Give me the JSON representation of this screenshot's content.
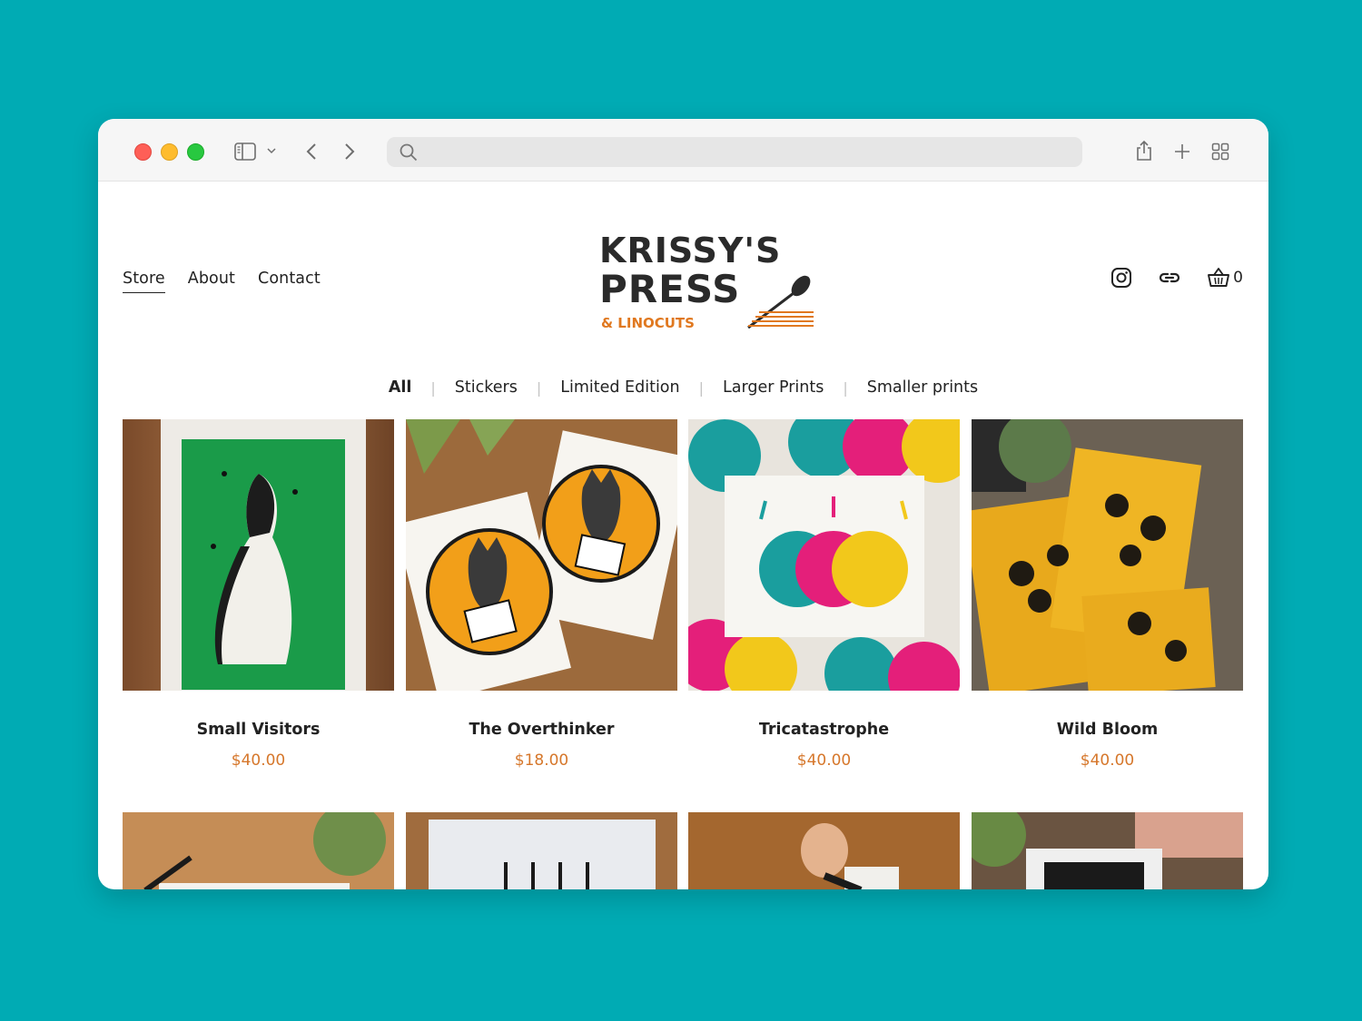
{
  "browser": {
    "url": "",
    "colors": {
      "close": "#fe5f57",
      "minimize": "#febc2e",
      "maximize": "#28c840"
    }
  },
  "site": {
    "logo": {
      "line1": "KRISSY'S",
      "line2": "PRESS",
      "line3": "& LINOCUTS"
    },
    "nav": [
      {
        "label": "Store",
        "active": true
      },
      {
        "label": "About"
      },
      {
        "label": "Contact"
      }
    ],
    "cart_count": "0",
    "icons": [
      "instagram-icon",
      "link-icon",
      "basket-icon"
    ]
  },
  "filters": [
    {
      "label": "All",
      "active": true
    },
    {
      "label": "Stickers"
    },
    {
      "label": "Limited Edition"
    },
    {
      "label": "Larger Prints"
    },
    {
      "label": "Smaller prints"
    }
  ],
  "products": [
    {
      "title": "Small Visitors",
      "price": "$40.00"
    },
    {
      "title": "The Overthinker",
      "price": "$18.00"
    },
    {
      "title": "Tricatastrophe",
      "price": "$40.00"
    },
    {
      "title": "Wild Bloom",
      "price": "$40.00"
    }
  ],
  "accent_color": "#d6772b",
  "background_color": "#00abb4"
}
